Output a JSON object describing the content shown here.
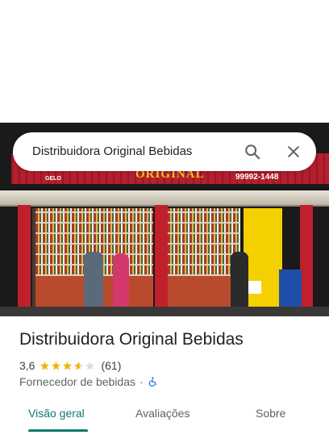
{
  "search": {
    "query": "Distribuidora Original Bebidas",
    "search_icon": "search-icon",
    "close_icon": "close-icon"
  },
  "photo": {
    "sign_text": "ORIGINAL",
    "sign_phone": "99992-1448",
    "sign_left": "GELO"
  },
  "place": {
    "title": "Distribuidora Original Bebidas",
    "rating": "3,6",
    "stars_value": 3.6,
    "review_count": "(61)",
    "category": "Fornecedor de bebidas",
    "separator": "·",
    "accessibility_icon": "wheelchair-icon"
  },
  "tabs": [
    {
      "label": "Visão geral",
      "active": true
    },
    {
      "label": "Avaliações",
      "active": false
    },
    {
      "label": "Sobre",
      "active": false
    }
  ],
  "colors": {
    "accent": "#0b7a6f",
    "star": "#f5b400",
    "star_empty": "#dadce0",
    "accessibility": "#1a73e8"
  }
}
